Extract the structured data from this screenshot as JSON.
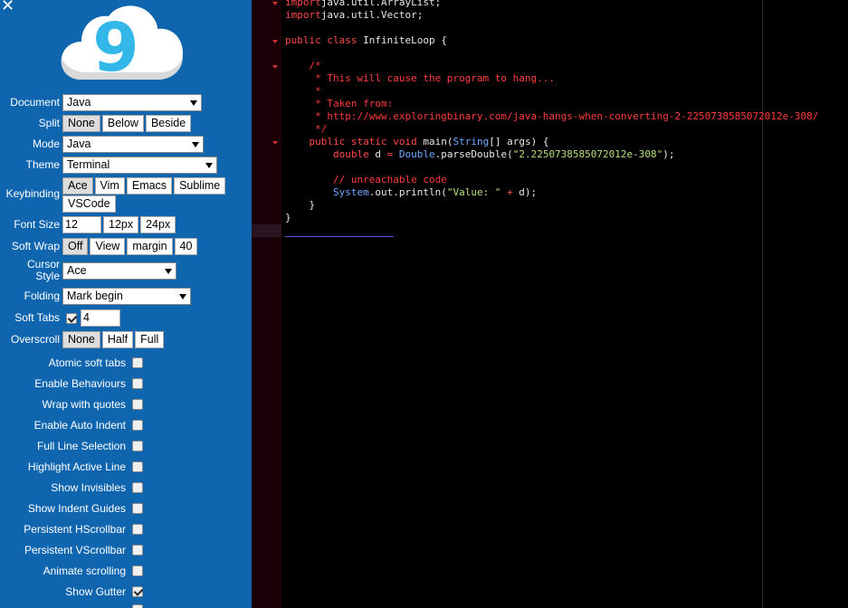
{
  "settings": {
    "close_glyph": "✕",
    "logo_digit": "9",
    "document": {
      "label": "Document",
      "value": "Java"
    },
    "split": {
      "label": "Split",
      "options": [
        "None",
        "Below",
        "Beside"
      ]
    },
    "mode": {
      "label": "Mode",
      "value": "Java"
    },
    "theme": {
      "label": "Theme",
      "value": "Terminal"
    },
    "keybinding": {
      "label": "Keybinding",
      "options": [
        "Ace",
        "Vim",
        "Emacs",
        "Sublime",
        "VSCode"
      ]
    },
    "font_size": {
      "label": "Font Size",
      "value": "12",
      "options": [
        "12px",
        "24px"
      ]
    },
    "soft_wrap": {
      "label": "Soft Wrap",
      "options": [
        "Off",
        "View",
        "margin",
        "40"
      ]
    },
    "cursor_style": {
      "label": "Cursor Style",
      "value": "Ace"
    },
    "folding": {
      "label": "Folding",
      "value": "Mark begin"
    },
    "soft_tabs": {
      "label": "Soft Tabs",
      "value": "4",
      "checked": true
    },
    "overscroll": {
      "label": "Overscroll",
      "options": [
        "None",
        "Half",
        "Full"
      ]
    },
    "checkboxes": [
      {
        "label": "Atomic soft tabs",
        "checked": false
      },
      {
        "label": "Enable Behaviours",
        "checked": false
      },
      {
        "label": "Wrap with quotes",
        "checked": false
      },
      {
        "label": "Enable Auto Indent",
        "checked": false
      },
      {
        "label": "Full Line Selection",
        "checked": false
      },
      {
        "label": "Highlight Active Line",
        "checked": false
      },
      {
        "label": "Show Invisibles",
        "checked": false
      },
      {
        "label": "Show Indent Guides",
        "checked": false
      },
      {
        "label": "Persistent HScrollbar",
        "checked": false
      },
      {
        "label": "Persistent VScrollbar",
        "checked": false
      },
      {
        "label": "Animate scrolling",
        "checked": false
      },
      {
        "label": "Show Gutter",
        "checked": true
      }
    ]
  },
  "editor": {
    "code": [
      [
        [
          "kw",
          "import"
        ],
        [
          "",
          "java.util.ArrayList;"
        ]
      ],
      [
        [
          "kw",
          "import"
        ],
        [
          "",
          "java.util.Vector;"
        ]
      ],
      [],
      [
        [
          "kw",
          "public class"
        ],
        [
          "",
          " InfiniteLoop {"
        ]
      ],
      [],
      [
        [
          "cm",
          "    /*"
        ]
      ],
      [
        [
          "cm",
          "     * This will cause the program to hang..."
        ]
      ],
      [
        [
          "cm",
          "     *"
        ]
      ],
      [
        [
          "cm",
          "     * Taken from:"
        ]
      ],
      [
        [
          "cm",
          "     * http://www.exploringbinary.com/java-hangs-when-converting-2-2250738585072012e-308/"
        ]
      ],
      [
        [
          "cm",
          "     */"
        ]
      ],
      [
        [
          "",
          "    "
        ],
        [
          "kw",
          "public static void"
        ],
        [
          "",
          " main("
        ],
        [
          "ty",
          "String"
        ],
        [
          "",
          "[] args) {"
        ]
      ],
      [
        [
          "",
          "        "
        ],
        [
          "kw",
          "double"
        ],
        [
          "",
          " d "
        ],
        [
          "op",
          "="
        ],
        [
          "",
          " "
        ],
        [
          "ty",
          "Double"
        ],
        [
          "",
          ".parseDouble("
        ],
        [
          "st",
          "\"2.2250738585072012e-308\""
        ],
        [
          "",
          ");"
        ]
      ],
      [],
      [
        [
          "cm",
          "        // unreachable code"
        ]
      ],
      [
        [
          "",
          "        "
        ],
        [
          "ty",
          "System"
        ],
        [
          "",
          ".out.println("
        ],
        [
          "st",
          "\"Value: \""
        ],
        [
          "",
          " "
        ],
        [
          "op",
          "+"
        ],
        [
          "",
          " d);"
        ]
      ],
      [
        [
          "",
          "    }"
        ]
      ],
      [
        [
          "",
          "}"
        ]
      ]
    ]
  }
}
